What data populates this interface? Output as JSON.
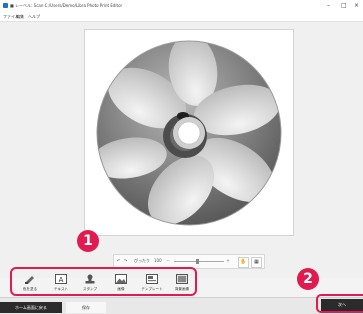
{
  "window": {
    "title": "■ レーベル: Scan C:/Users/Demo/Libra Photo Print Editor",
    "minimize_glyph": "–",
    "maximize_glyph": "□",
    "close_glyph": "×"
  },
  "menu": [
    "ファイル",
    "編集",
    "ヘルプ"
  ],
  "zoom_toolbar": {
    "undo_glyph": "↶",
    "redo_glyph": "↷",
    "fit_label": "ぴったり",
    "zoom_value": "100",
    "zoom_out_glyph": "－",
    "zoom_in_glyph": "＋",
    "hand_glyph": "✋",
    "grid_glyph": "▦"
  },
  "tools": [
    {
      "label": "色を塗る",
      "icon": "fill-brush-icon"
    },
    {
      "label": "テキスト",
      "icon": "text-icon"
    },
    {
      "label": "スタンプ",
      "icon": "stamp-icon"
    },
    {
      "label": "画像",
      "icon": "image-icon"
    },
    {
      "label": "テンプレート",
      "icon": "template-icon"
    },
    {
      "label": "背景画像",
      "icon": "background-image-icon"
    }
  ],
  "badges": {
    "one": "1",
    "two": "2"
  },
  "bottom": {
    "left_tab": "ホーム画面に戻る",
    "right_tab": "保存",
    "next_button": "次へ"
  },
  "colors": {
    "accent": "#e11b4f",
    "dark": "#2b2b2b"
  }
}
